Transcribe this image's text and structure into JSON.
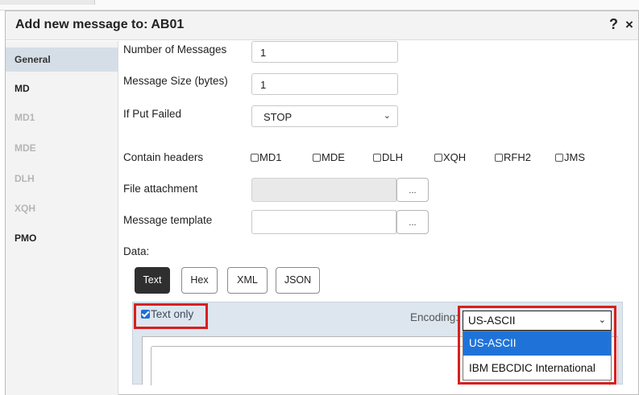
{
  "dialog": {
    "title": "Add new message to: AB01",
    "help_symbol": "?",
    "close_symbol": "×"
  },
  "sidebar": {
    "items": [
      {
        "label": "General",
        "state": "active"
      },
      {
        "label": "MD",
        "state": "enabled"
      },
      {
        "label": "MD1",
        "state": "disabled"
      },
      {
        "label": "MDE",
        "state": "disabled"
      },
      {
        "label": "DLH",
        "state": "disabled"
      },
      {
        "label": "XQH",
        "state": "disabled"
      },
      {
        "label": "PMO",
        "state": "enabled"
      }
    ]
  },
  "form": {
    "num_messages_label": "Number of Messages",
    "num_messages_value": "1",
    "msg_size_label": "Message Size (bytes)",
    "msg_size_value": "1",
    "put_failed_label": "If Put Failed",
    "put_failed_value": "STOP",
    "contain_headers_label": "Contain headers",
    "headers": [
      "MD1",
      "MDE",
      "DLH",
      "XQH",
      "RFH2",
      "JMS"
    ],
    "file_attachment_label": "File attachment",
    "file_attachment_value": "",
    "browse_label": "...",
    "template_label": "Message template",
    "template_value": "",
    "data_label": "Data:"
  },
  "data_panel": {
    "formats": [
      "Text",
      "Hex",
      "XML",
      "JSON"
    ],
    "active_format": "Text",
    "text_only_label": "Text only",
    "text_only_checked": true,
    "encoding_label": "Encoding:",
    "encoding_value": "US-ASCII",
    "encoding_options": [
      "US-ASCII",
      "IBM EBCDIC International"
    ],
    "encoding_highlighted": "US-ASCII"
  },
  "colors": {
    "accent_blue": "#1f73d8",
    "highlight_red": "#d81f1f",
    "active_tab_bg": "#d5dee6",
    "panel_bg": "#dde6ee",
    "active_button_bg": "#2f2f2f"
  },
  "icons": {
    "help": "help-icon",
    "close": "close-icon",
    "chevron": "chevron-down-icon",
    "checkbox": "checkbox-icon"
  }
}
